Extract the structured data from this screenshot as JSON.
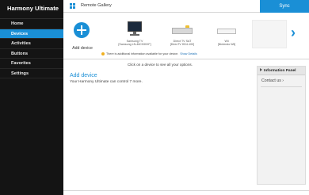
{
  "app": {
    "title": "Harmony Ultimate"
  },
  "sidebar": {
    "items": [
      {
        "label": "Home"
      },
      {
        "label": "Devices"
      },
      {
        "label": "Activities"
      },
      {
        "label": "Buttons"
      },
      {
        "label": "Favorites"
      },
      {
        "label": "Settings"
      }
    ],
    "active": "Devices"
  },
  "header": {
    "gallery_title": "Remote Gallery",
    "sync_label": "Sync"
  },
  "devices": {
    "add_label": "Add device",
    "items": [
      {
        "name": "Samsung TV",
        "model": "[Samsung LN-46C530XF]",
        "icon": "tv-icon"
      },
      {
        "name": "Direct TV SAT",
        "model": "[DirecTV HD4-100]",
        "icon": "set-top-box-icon"
      },
      {
        "name": "Wii",
        "model": "[Nintendo Wii]",
        "icon": "game-console-icon"
      }
    ],
    "notice_text": "There is additional information available for your device.",
    "notice_link": "Show Details",
    "next_icon": "chevron-right-icon"
  },
  "main": {
    "hint": "Click on a device to see all your options.",
    "add_link": "Add device",
    "capacity_text": "Your Harmony Ultimate can control 7 more."
  },
  "info_panel": {
    "title": "Information Panel",
    "contact": "Contact us",
    "contact_arrow": "›"
  },
  "colors": {
    "accent": "#1a8fd6",
    "sidebar_bg": "#141414",
    "notice_dot": "#f0b020"
  }
}
